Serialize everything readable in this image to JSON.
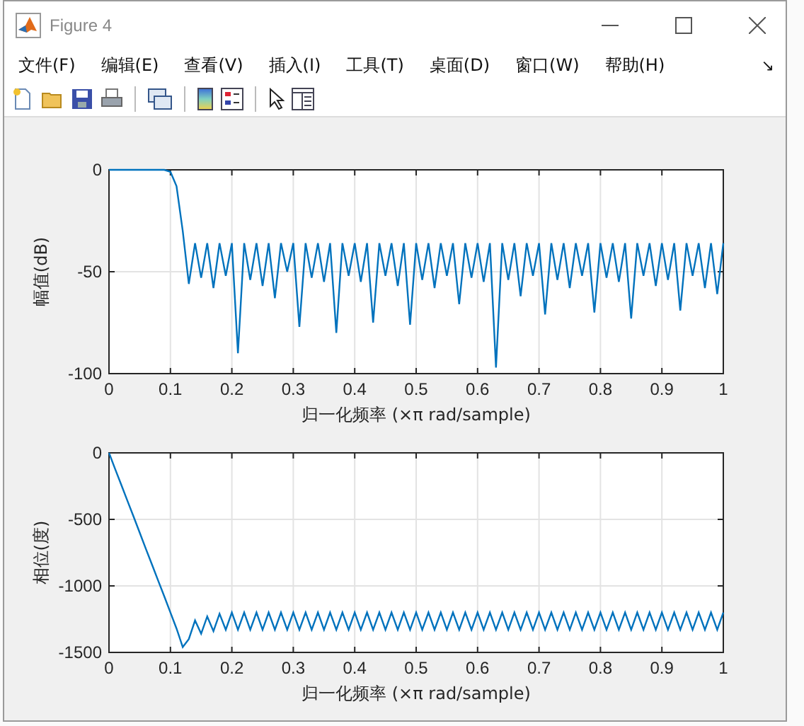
{
  "window": {
    "title": "Figure 4"
  },
  "menu": [
    {
      "label": "文件(F)"
    },
    {
      "label": "编辑(E)"
    },
    {
      "label": "查看(V)"
    },
    {
      "label": "插入(I)"
    },
    {
      "label": "工具(T)"
    },
    {
      "label": "桌面(D)"
    },
    {
      "label": "窗口(W)"
    },
    {
      "label": "帮助(H)"
    }
  ],
  "menu_corner": "↘",
  "plots": [
    {
      "chart_data": {
        "type": "line",
        "grid": true,
        "xlabel": "归一化频率 (×π rad/sample)",
        "ylabel": "幅值(dB)",
        "xlim": [
          0,
          1
        ],
        "ylim": [
          -100,
          0
        ],
        "xticks": [
          0,
          0.1,
          0.2,
          0.3,
          0.4,
          0.5,
          0.6,
          0.7,
          0.8,
          0.9,
          1
        ],
        "yticks": [
          -100,
          -50,
          0
        ],
        "x": [
          0,
          0.01,
          0.02,
          0.03,
          0.04,
          0.05,
          0.06,
          0.07,
          0.08,
          0.09,
          0.1,
          0.11,
          0.12,
          0.13,
          0.14,
          0.15,
          0.16,
          0.17,
          0.18,
          0.19,
          0.2,
          0.21,
          0.22,
          0.23,
          0.24,
          0.25,
          0.26,
          0.27,
          0.28,
          0.29,
          0.3,
          0.31,
          0.32,
          0.33,
          0.34,
          0.35,
          0.36,
          0.37,
          0.38,
          0.39,
          0.4,
          0.41,
          0.42,
          0.43,
          0.44,
          0.45,
          0.46,
          0.47,
          0.48,
          0.49,
          0.5,
          0.51,
          0.52,
          0.53,
          0.54,
          0.55,
          0.56,
          0.57,
          0.58,
          0.59,
          0.6,
          0.61,
          0.62,
          0.63,
          0.64,
          0.65,
          0.66,
          0.67,
          0.68,
          0.69,
          0.7,
          0.71,
          0.72,
          0.73,
          0.74,
          0.75,
          0.76,
          0.77,
          0.78,
          0.79,
          0.8,
          0.81,
          0.82,
          0.83,
          0.84,
          0.85,
          0.86,
          0.87,
          0.88,
          0.89,
          0.9,
          0.91,
          0.92,
          0.93,
          0.94,
          0.95,
          0.96,
          0.97,
          0.98,
          0.99,
          1
        ],
        "series": [
          {
            "color": "#0072bd",
            "values": [
              0,
              0,
              0,
              0,
              0,
              0,
              0,
              0,
              0,
              0,
              -1,
              -8,
              -30,
              -56,
              -36,
              -53,
              -36,
              -58,
              -36,
              -52,
              -36,
              -90,
              -36,
              -54,
              -36,
              -57,
              -36,
              -63,
              -36,
              -50,
              -36,
              -77,
              -36,
              -53,
              -36,
              -55,
              -36,
              -80,
              -36,
              -52,
              -36,
              -55,
              -36,
              -75,
              -36,
              -52,
              -36,
              -57,
              -36,
              -76,
              -36,
              -54,
              -36,
              -58,
              -36,
              -52,
              -36,
              -66,
              -36,
              -53,
              -36,
              -55,
              -36,
              -97,
              -36,
              -54,
              -36,
              -62,
              -36,
              -52,
              -36,
              -71,
              -36,
              -54,
              -36,
              -58,
              -36,
              -52,
              -36,
              -70,
              -36,
              -53,
              -36,
              -55,
              -36,
              -73,
              -36,
              -52,
              -36,
              -57,
              -36,
              -54,
              -36,
              -69,
              -36,
              -52,
              -36,
              -58,
              -36,
              -61,
              -36
            ]
          }
        ]
      }
    },
    {
      "chart_data": {
        "type": "line",
        "grid": true,
        "xlabel": "归一化频率 (×π rad/sample)",
        "ylabel": "相位(度)",
        "xlim": [
          0,
          1
        ],
        "ylim": [
          -1500,
          0
        ],
        "xticks": [
          0,
          0.1,
          0.2,
          0.3,
          0.4,
          0.5,
          0.6,
          0.7,
          0.8,
          0.9,
          1
        ],
        "yticks": [
          -1500,
          -1000,
          -500,
          0
        ],
        "x": [
          0,
          0.01,
          0.02,
          0.03,
          0.04,
          0.05,
          0.06,
          0.07,
          0.08,
          0.09,
          0.1,
          0.11,
          0.12,
          0.13,
          0.14,
          0.15,
          0.16,
          0.17,
          0.18,
          0.19,
          0.2,
          0.21,
          0.22,
          0.23,
          0.24,
          0.25,
          0.26,
          0.27,
          0.28,
          0.29,
          0.3,
          0.31,
          0.32,
          0.33,
          0.34,
          0.35,
          0.36,
          0.37,
          0.38,
          0.39,
          0.4,
          0.41,
          0.42,
          0.43,
          0.44,
          0.45,
          0.46,
          0.47,
          0.48,
          0.49,
          0.5,
          0.51,
          0.52,
          0.53,
          0.54,
          0.55,
          0.56,
          0.57,
          0.58,
          0.59,
          0.6,
          0.61,
          0.62,
          0.63,
          0.64,
          0.65,
          0.66,
          0.67,
          0.68,
          0.69,
          0.7,
          0.71,
          0.72,
          0.73,
          0.74,
          0.75,
          0.76,
          0.77,
          0.78,
          0.79,
          0.8,
          0.81,
          0.82,
          0.83,
          0.84,
          0.85,
          0.86,
          0.87,
          0.88,
          0.89,
          0.9,
          0.91,
          0.92,
          0.93,
          0.94,
          0.95,
          0.96,
          0.97,
          0.98,
          0.99,
          1
        ],
        "series": [
          {
            "color": "#0072bd",
            "values": [
              0,
              -120,
              -240,
              -360,
              -480,
              -600,
              -720,
              -840,
              -960,
              -1080,
              -1200,
              -1320,
              -1460,
              -1400,
              -1260,
              -1360,
              -1230,
              -1340,
              -1210,
              -1330,
              -1200,
              -1330,
              -1200,
              -1330,
              -1200,
              -1330,
              -1200,
              -1330,
              -1200,
              -1330,
              -1200,
              -1330,
              -1200,
              -1330,
              -1200,
              -1330,
              -1200,
              -1330,
              -1200,
              -1330,
              -1200,
              -1330,
              -1200,
              -1330,
              -1200,
              -1330,
              -1200,
              -1330,
              -1200,
              -1330,
              -1200,
              -1330,
              -1200,
              -1330,
              -1200,
              -1330,
              -1200,
              -1330,
              -1200,
              -1330,
              -1200,
              -1330,
              -1200,
              -1330,
              -1200,
              -1330,
              -1200,
              -1330,
              -1200,
              -1330,
              -1200,
              -1330,
              -1200,
              -1330,
              -1200,
              -1330,
              -1200,
              -1330,
              -1200,
              -1330,
              -1200,
              -1330,
              -1200,
              -1330,
              -1200,
              -1330,
              -1200,
              -1330,
              -1200,
              -1330,
              -1200,
              -1330,
              -1200,
              -1330,
              -1200,
              -1330,
              -1200,
              -1330,
              -1200,
              -1330,
              -1200
            ]
          }
        ]
      }
    }
  ]
}
